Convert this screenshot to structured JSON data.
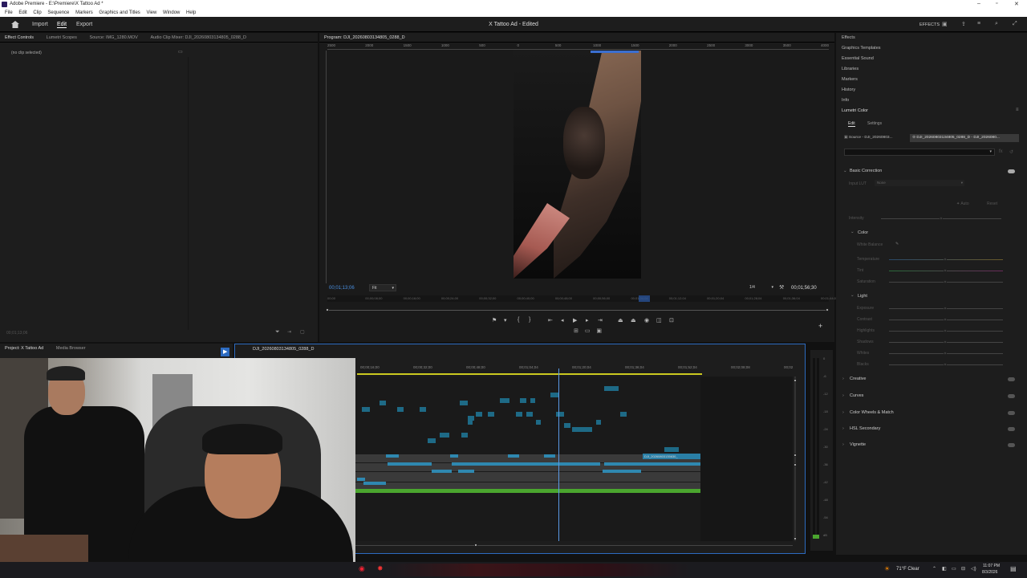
{
  "window": {
    "title": "Adobe Premiere - E:\\Premiere\\X Tattoo Ad *"
  },
  "menu": [
    "File",
    "Edit",
    "Clip",
    "Sequence",
    "Markers",
    "Graphics and Titles",
    "View",
    "Window",
    "Help"
  ],
  "header": {
    "nav": [
      "Import",
      "Edit",
      "Export"
    ],
    "active_nav": "Edit",
    "doc_title": "X Tattoo Ad - Edited",
    "effects_label": "EFFECTS"
  },
  "source_panel": {
    "tabs": [
      "Effect Controls",
      "Lumetri Scopes",
      "Source: IMG_1280.MOV",
      "Audio Clip Mixer: DJI_20260803134805_0288_D"
    ],
    "no_clip": "(no clip selected)",
    "timecode": "00;01;13;06"
  },
  "program_panel": {
    "tab": "Program: DJI_20260803134805_0288_D",
    "ruler_ticks": [
      "2500",
      "2000",
      "1500",
      "1000",
      "500",
      "0",
      "500",
      "1000",
      "1500",
      "2000",
      "2500",
      "3000",
      "3500",
      "4000"
    ],
    "current_timecode": "00;01;13;06",
    "fit_label": "Fit",
    "quality_label": "1/4",
    "duration_timecode": "00;01;56;30",
    "scrub_ticks": [
      "00;00",
      "00;00;08;00",
      "00;00;16;00",
      "00;00;24;00",
      "00;00;32;00",
      "00;00;40;00",
      "00;00;48;00",
      "00;00;56;00",
      "00;01;04;04",
      "00;01;12;04",
      "00;01;20;04",
      "00;01;28;04",
      "00;01;36;04",
      "00;01;44;04"
    ]
  },
  "project_panel": {
    "tabs": [
      "Project: X Tattoo Ad",
      "Media Browser"
    ]
  },
  "timeline": {
    "tab": "DJI_20260803134805_0288_D",
    "ruler": [
      "00;00;16;00",
      "00;00;32;00",
      "00;00;48;00",
      "00;01;04;04",
      "00;01;20;04",
      "00;01;36;04",
      "00;01;52;04",
      "00;02;08;08",
      "00;02"
    ],
    "clip_label": "DJI_20260803135630_",
    "fx_badge": "fx",
    "vu_scale": [
      "0",
      "-6",
      "-12",
      "-18",
      "-24",
      "-30",
      "-36",
      "-42",
      "-48",
      "-54",
      "dB"
    ]
  },
  "right_panel": {
    "items": [
      "Effects",
      "Graphics Templates",
      "Essential Sound",
      "Libraries",
      "Markers",
      "History",
      "Info",
      "Lumetri Color"
    ],
    "lumetri": {
      "tabs": [
        "Edit",
        "Settings"
      ],
      "source_label": "Source - DJI_20260803...",
      "clip_label": "DJI_20260803134805_0288_D - DJI_2026080...",
      "basic_correction": "Basic Correction",
      "input_lut_label": "Input LUT",
      "input_lut_value": "None",
      "auto": "Auto",
      "reset": "Reset",
      "intensity": "Intensity",
      "color_section": "Color",
      "white_balance": "White Balance",
      "color_rows": [
        "Temperature",
        "Tint",
        "Saturation"
      ],
      "light_section": "Light",
      "light_rows": [
        "Exposure",
        "Contrast",
        "Highlights",
        "Shadows",
        "Whites",
        "Blacks"
      ],
      "sections": [
        "Creative",
        "Curves",
        "Color Wheels & Match",
        "HSL Secondary",
        "Vignette"
      ]
    }
  },
  "taskbar": {
    "weather": "71°F Clear",
    "time": "11:07 PM",
    "date": "8/3/2026"
  }
}
